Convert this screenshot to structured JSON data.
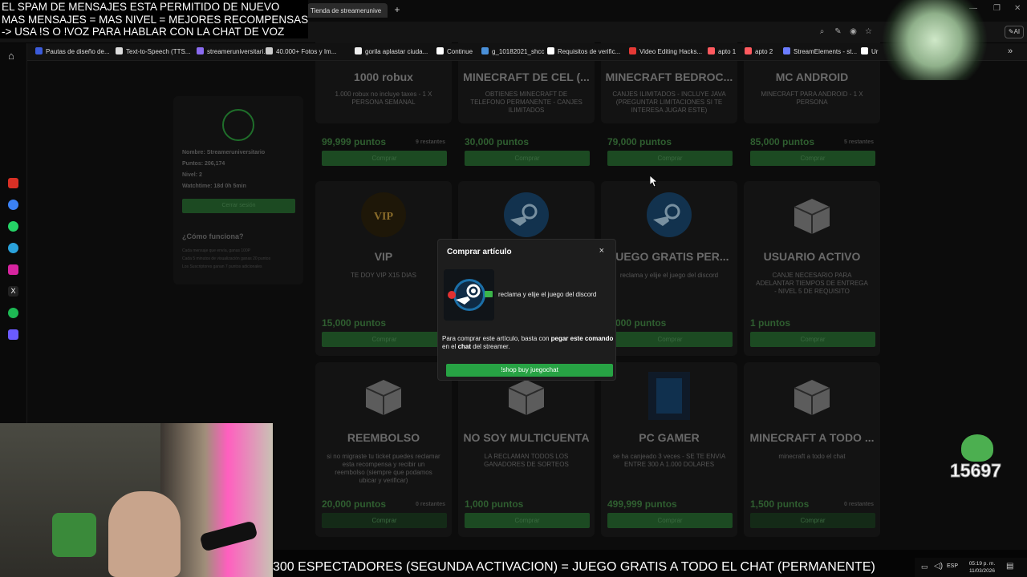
{
  "overlay": {
    "spam_lines": [
      "EL SPAM DE MENSAJES ESTA PERMITIDO DE NUEVO",
      "MAS MENSAJES = MAS NIVEL = MEJORES RECOMPENSAS",
      "-> USA !S O !VOZ PARA HABLAR CON LA CHAT DE VOZ"
    ],
    "ticker": "300 ESPECTADORES (SEGUNDA ACTIVACION) = JUEGO GRATIS A TODO EL CHAT (PERMANENTE)",
    "counter": "15697"
  },
  "browser": {
    "tab_title": "Tienda de streamerunive",
    "new_tab": "+",
    "bookmarks": [
      {
        "label": "Pautas de diseño de...",
        "color": "#3b5bdb"
      },
      {
        "label": "Text-to-Speech (TTS...",
        "color": "#dddddd"
      },
      {
        "label": "streameruniversitari...",
        "color": "#8a6bf0"
      },
      {
        "label": "40.000+ Fotos y Im...",
        "color": "#cccccc"
      },
      {
        "label": "gorila aplastar ciuda...",
        "color": "#eeeeee"
      },
      {
        "label": "Continue",
        "color": "#ffffff"
      },
      {
        "label": "g_10182021_shcc",
        "color": "#4a90d9"
      },
      {
        "label": "Requisitos de verific...",
        "color": "#ffffff"
      },
      {
        "label": "Video Editing Hacks...",
        "color": "#e53935"
      },
      {
        "label": "apto 1",
        "color": "#ff5a5f"
      },
      {
        "label": "apto 2",
        "color": "#ff5a5f"
      },
      {
        "label": "StreamElements - st...",
        "color": "#6b7cff"
      },
      {
        "label": "Ur",
        "color": "#ffffff"
      }
    ],
    "more": "»"
  },
  "profile": {
    "name": "Nombre: Streameruniversitario",
    "points": "Puntos: 206,174",
    "level": "Nivel: 2",
    "watchtime": "Watchtime: 18d 0h 5min",
    "logout": "Cerrar sesión",
    "how_title": "¿Cómo funciona?",
    "how_lines": [
      "Cada mensaje que envía, ganas 100P",
      "Cada 5 minutos de visualización ganas 20 puntos",
      "Los Suscriptores ganan 7 puntos adicionales"
    ]
  },
  "store": {
    "buy_label": "Comprar",
    "items": [
      {
        "title": "1000 robux",
        "desc": "1.000 robux no incluye taxes - 1 X PERSONA SEMANAL",
        "price": "99,999 puntos",
        "remaining": "9 restantes",
        "icon": "robux-icon",
        "disabled": false
      },
      {
        "title": "MINECRAFT DE CEL (...",
        "desc": "OBTIENES MINECRAFT DE TELEFONO PERMANENTE - CANJES ILIMITADOS",
        "price": "30,000 puntos",
        "remaining": "",
        "icon": "minecraft-icon",
        "disabled": false
      },
      {
        "title": "MINECRAFT BEDROC...",
        "desc": "CANJES ILIMITADOS - INCLUYE JAVA (PREGUNTAR LIMITACIONES SI TE INTERESA JUGAR ESTE)",
        "price": "79,000 puntos",
        "remaining": "",
        "icon": "minecraft-icon",
        "disabled": false
      },
      {
        "title": "MC ANDROID",
        "desc": "MINECRAFT PARA ANDROID - 1 X PERSONA",
        "price": "85,000 puntos",
        "remaining": "5 restantes",
        "icon": "android-icon",
        "disabled": false
      },
      {
        "title": "VIP",
        "desc": "TE DOY VIP X15 DIAS",
        "price": "15,000 puntos",
        "remaining": "",
        "icon": "vip-icon",
        "disabled": false
      },
      {
        "title": "",
        "desc": "",
        "price": "",
        "remaining": "",
        "icon": "steam-icon",
        "disabled": false
      },
      {
        "title": "JUEGO GRATIS PER...",
        "desc": "reclama y elije el juego del discord",
        "price": "3,000 puntos",
        "remaining": "",
        "icon": "steam-icon",
        "disabled": false
      },
      {
        "title": "USUARIO ACTIVO",
        "desc": "CANJE NECESARIO PARA ADELANTAR TIEMPOS DE ENTREGA - NIVEL 5 DE REQUISITO",
        "price": "1 puntos",
        "remaining": "",
        "icon": "box-icon",
        "disabled": false
      },
      {
        "title": "REEMBOLSO",
        "desc": "si no migraste tu ticket puedes reclamar esta recompensa y recibir un reembolso (siempre que podamos ubicar y verificar)",
        "price": "20,000 puntos",
        "remaining": "0 restantes",
        "icon": "box-icon",
        "disabled": true
      },
      {
        "title": "NO SOY MULTICUENTA",
        "desc": "LA RECLAMAN TODOS LOS GANADORES DE SORTEOS",
        "price": "1,000 puntos",
        "remaining": "",
        "icon": "box-icon",
        "disabled": false
      },
      {
        "title": "PC GAMER",
        "desc": "se ha canjeado 3 veces - SE TE ENVIA ENTRE 300 A 1.000 DOLARES",
        "price": "499,999 puntos",
        "remaining": "",
        "icon": "pc-icon",
        "disabled": false
      },
      {
        "title": "MINECRAFT A TODO ...",
        "desc": "minecraft a todo el chat",
        "price": "1,500 puntos",
        "remaining": "0 restantes",
        "icon": "box-icon",
        "disabled": true
      }
    ]
  },
  "modal": {
    "title": "Comprar artículo",
    "close": "×",
    "item_desc": "reclama y elije el juego del discord",
    "info_pre": "Para comprar este artículo, basta con ",
    "info_bold1": "pegar este comando",
    "info_mid": " en el ",
    "info_bold2": "chat",
    "info_post": " del streamer.",
    "command": "!shop buy juegochat"
  },
  "taskbar": {
    "lang": "ESP",
    "time": "05:19 p. m.",
    "date": "11/03/2026"
  }
}
